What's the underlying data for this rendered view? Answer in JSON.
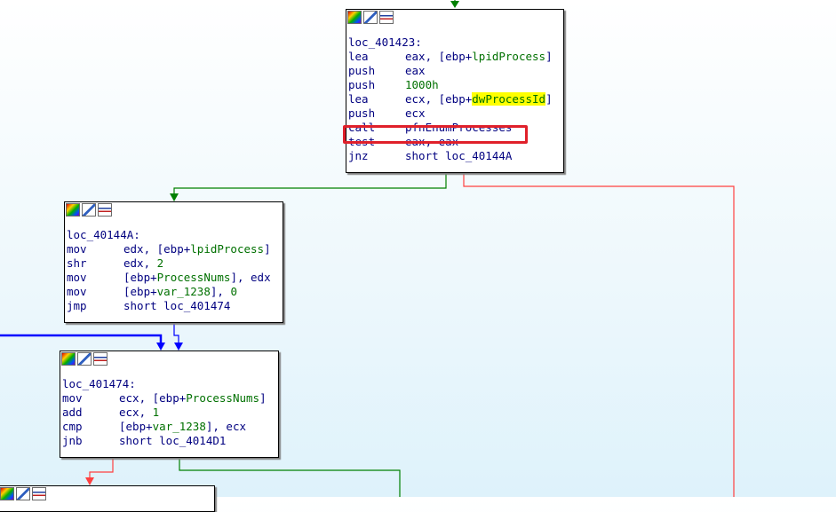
{
  "nodes": {
    "n401423": {
      "label": "loc_401423:",
      "lines": [
        {
          "ins": "lea",
          "a": "eax, [ebp+",
          "b": "lpidProcess",
          "c": "]"
        },
        {
          "ins": "push",
          "a": "eax",
          "b": "",
          "c": ""
        },
        {
          "ins": "push",
          "a": "",
          "b": "1000h",
          "c": ""
        },
        {
          "ins": "lea",
          "a": "ecx, [ebp+",
          "b": "dwProcessId",
          "c": "]"
        },
        {
          "ins": "push",
          "a": "ecx",
          "b": "",
          "c": ""
        },
        {
          "ins": "call",
          "a": "pfnEnumProcesses",
          "b": "",
          "c": ""
        },
        {
          "ins": "test",
          "a": "eax, eax",
          "b": "",
          "c": ""
        },
        {
          "ins": "jnz",
          "a": "short loc_40144A",
          "b": "",
          "c": ""
        }
      ]
    },
    "n40144A": {
      "label": "loc_40144A:",
      "lines": [
        {
          "ins": "mov",
          "a": "edx, [ebp+",
          "b": "lpidProcess",
          "c": "]"
        },
        {
          "ins": "shr",
          "a": "edx, ",
          "b": "2",
          "c": ""
        },
        {
          "ins": "mov",
          "a": "[ebp+",
          "b": "ProcessNums",
          "c": "], edx"
        },
        {
          "ins": "mov",
          "a": "[ebp+",
          "b": "var_1238",
          "c": "], "
        },
        {
          "ins": "jmp",
          "a": "short loc_401474",
          "b": "",
          "c": ""
        }
      ],
      "extra_zero": "0"
    },
    "n401474": {
      "label": "loc_401474:",
      "lines": [
        {
          "ins": "mov",
          "a": "ecx, [ebp+",
          "b": "ProcessNums",
          "c": "]"
        },
        {
          "ins": "add",
          "a": "ecx, ",
          "b": "1",
          "c": ""
        },
        {
          "ins": "cmp",
          "a": "[ebp+",
          "b": "var_1238",
          "c": "], ecx"
        },
        {
          "ins": "jnb",
          "a": "short loc_4014D1",
          "b": "",
          "c": ""
        }
      ]
    }
  },
  "highlighted_symbol": "dwProcessId",
  "highlighted_instruction": "call pfnEnumProcesses",
  "colors": {
    "edge_true": "#008000",
    "edge_false": "#ff4040",
    "edge_jump": "#0000ff",
    "annotation_box": "#e0202a",
    "symbol_highlight": "#ffff00"
  },
  "icons": [
    "color-node-icon",
    "rename-node-icon",
    "group-node-icon"
  ]
}
